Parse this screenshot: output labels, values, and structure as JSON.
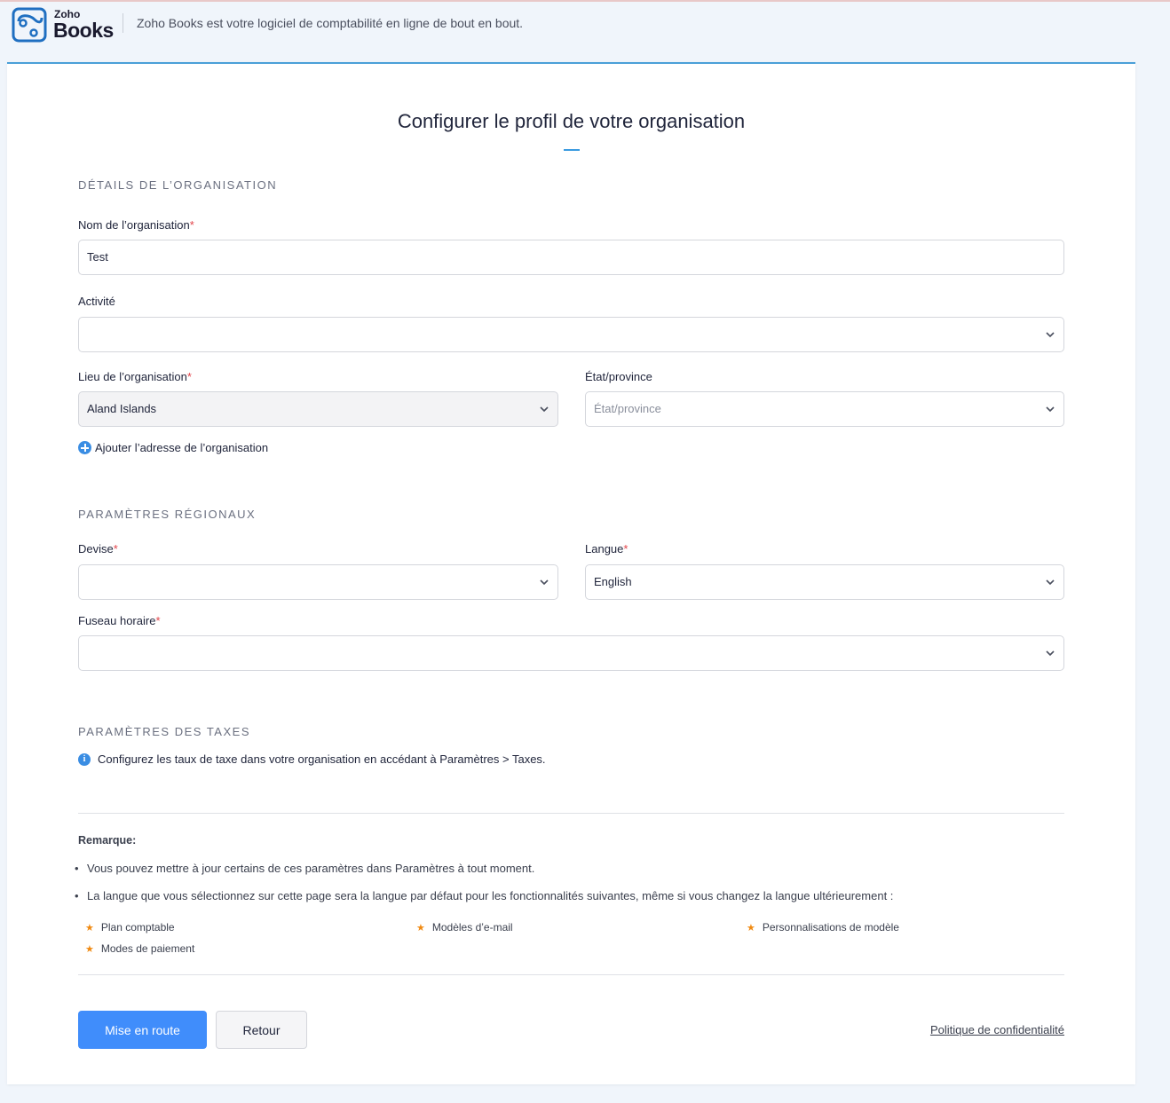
{
  "header": {
    "logo_small": "Zoho",
    "logo_big": "Books",
    "tagline": "Zoho Books est votre logiciel de comptabilité en ligne de bout en bout."
  },
  "page": {
    "title": "Configurer le profil de votre organisation"
  },
  "org_details": {
    "section_title": "DÉTAILS DE L’ORGANISATION",
    "name_label": "Nom de l’organisation",
    "name_value": "Test",
    "activity_label": "Activité",
    "activity_value": "",
    "location_label": "Lieu de l’organisation",
    "location_value": "Aland Islands",
    "state_label": "État/province",
    "state_placeholder": "État/province",
    "add_address": "Ajouter l’adresse de l’organisation"
  },
  "regional": {
    "section_title": "PARAMÈTRES RÉGIONAUX",
    "currency_label": "Devise",
    "currency_value": "",
    "language_label": "Langue",
    "language_value": "English",
    "timezone_label": "Fuseau horaire",
    "timezone_value": ""
  },
  "tax": {
    "section_title": "PARAMÈTRES DES TAXES",
    "info": "Configurez les taux de taxe dans votre organisation en accédant à Paramètres > Taxes."
  },
  "notes": {
    "title": "Remarque:",
    "bullets": [
      "Vous pouvez mettre à jour certains de ces paramètres dans Paramètres à tout moment.",
      "La langue que vous sélectionnez sur cette page sera la langue par défaut pour les fonctionnalités suivantes, même si vous changez la langue ultérieurement :"
    ],
    "features": [
      "Plan comptable",
      "Modèles d’e-mail",
      "Personnalisations de modèle",
      "Modes de paiement"
    ]
  },
  "actions": {
    "primary": "Mise en route",
    "secondary": "Retour",
    "privacy": "Politique de confidentialité"
  },
  "colors": {
    "accent": "#408dfb",
    "required": "#e2454b",
    "star": "#f08a12"
  }
}
